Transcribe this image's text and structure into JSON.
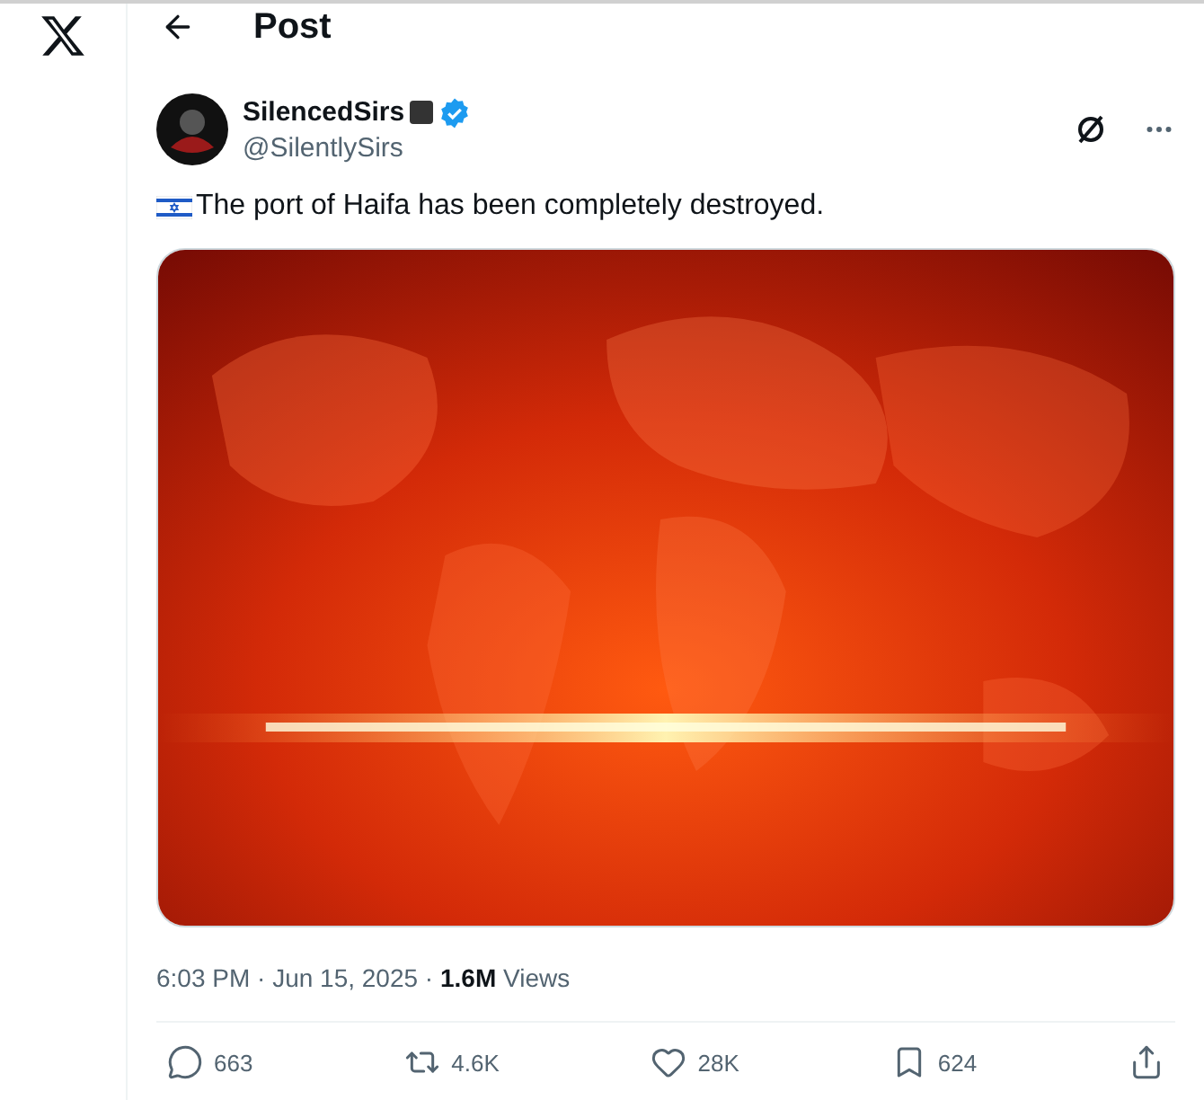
{
  "header": {
    "title": "Post"
  },
  "post": {
    "author": {
      "name": "SilencedSirs",
      "handle": "@SilentlySirs",
      "verified": true
    },
    "text": "The port of Haifa has been completely destroyed.",
    "meta": "6:03 PM · Jun 15, 2025 · **1.6M** Views",
    "actions": [
      {
        "kind": "reply",
        "count": "663"
      },
      {
        "kind": "repost",
        "count": "4.6K"
      },
      {
        "kind": "like",
        "count": "28K"
      },
      {
        "kind": "bookmark",
        "count": "624"
      },
      {
        "kind": "share"
      }
    ]
  }
}
